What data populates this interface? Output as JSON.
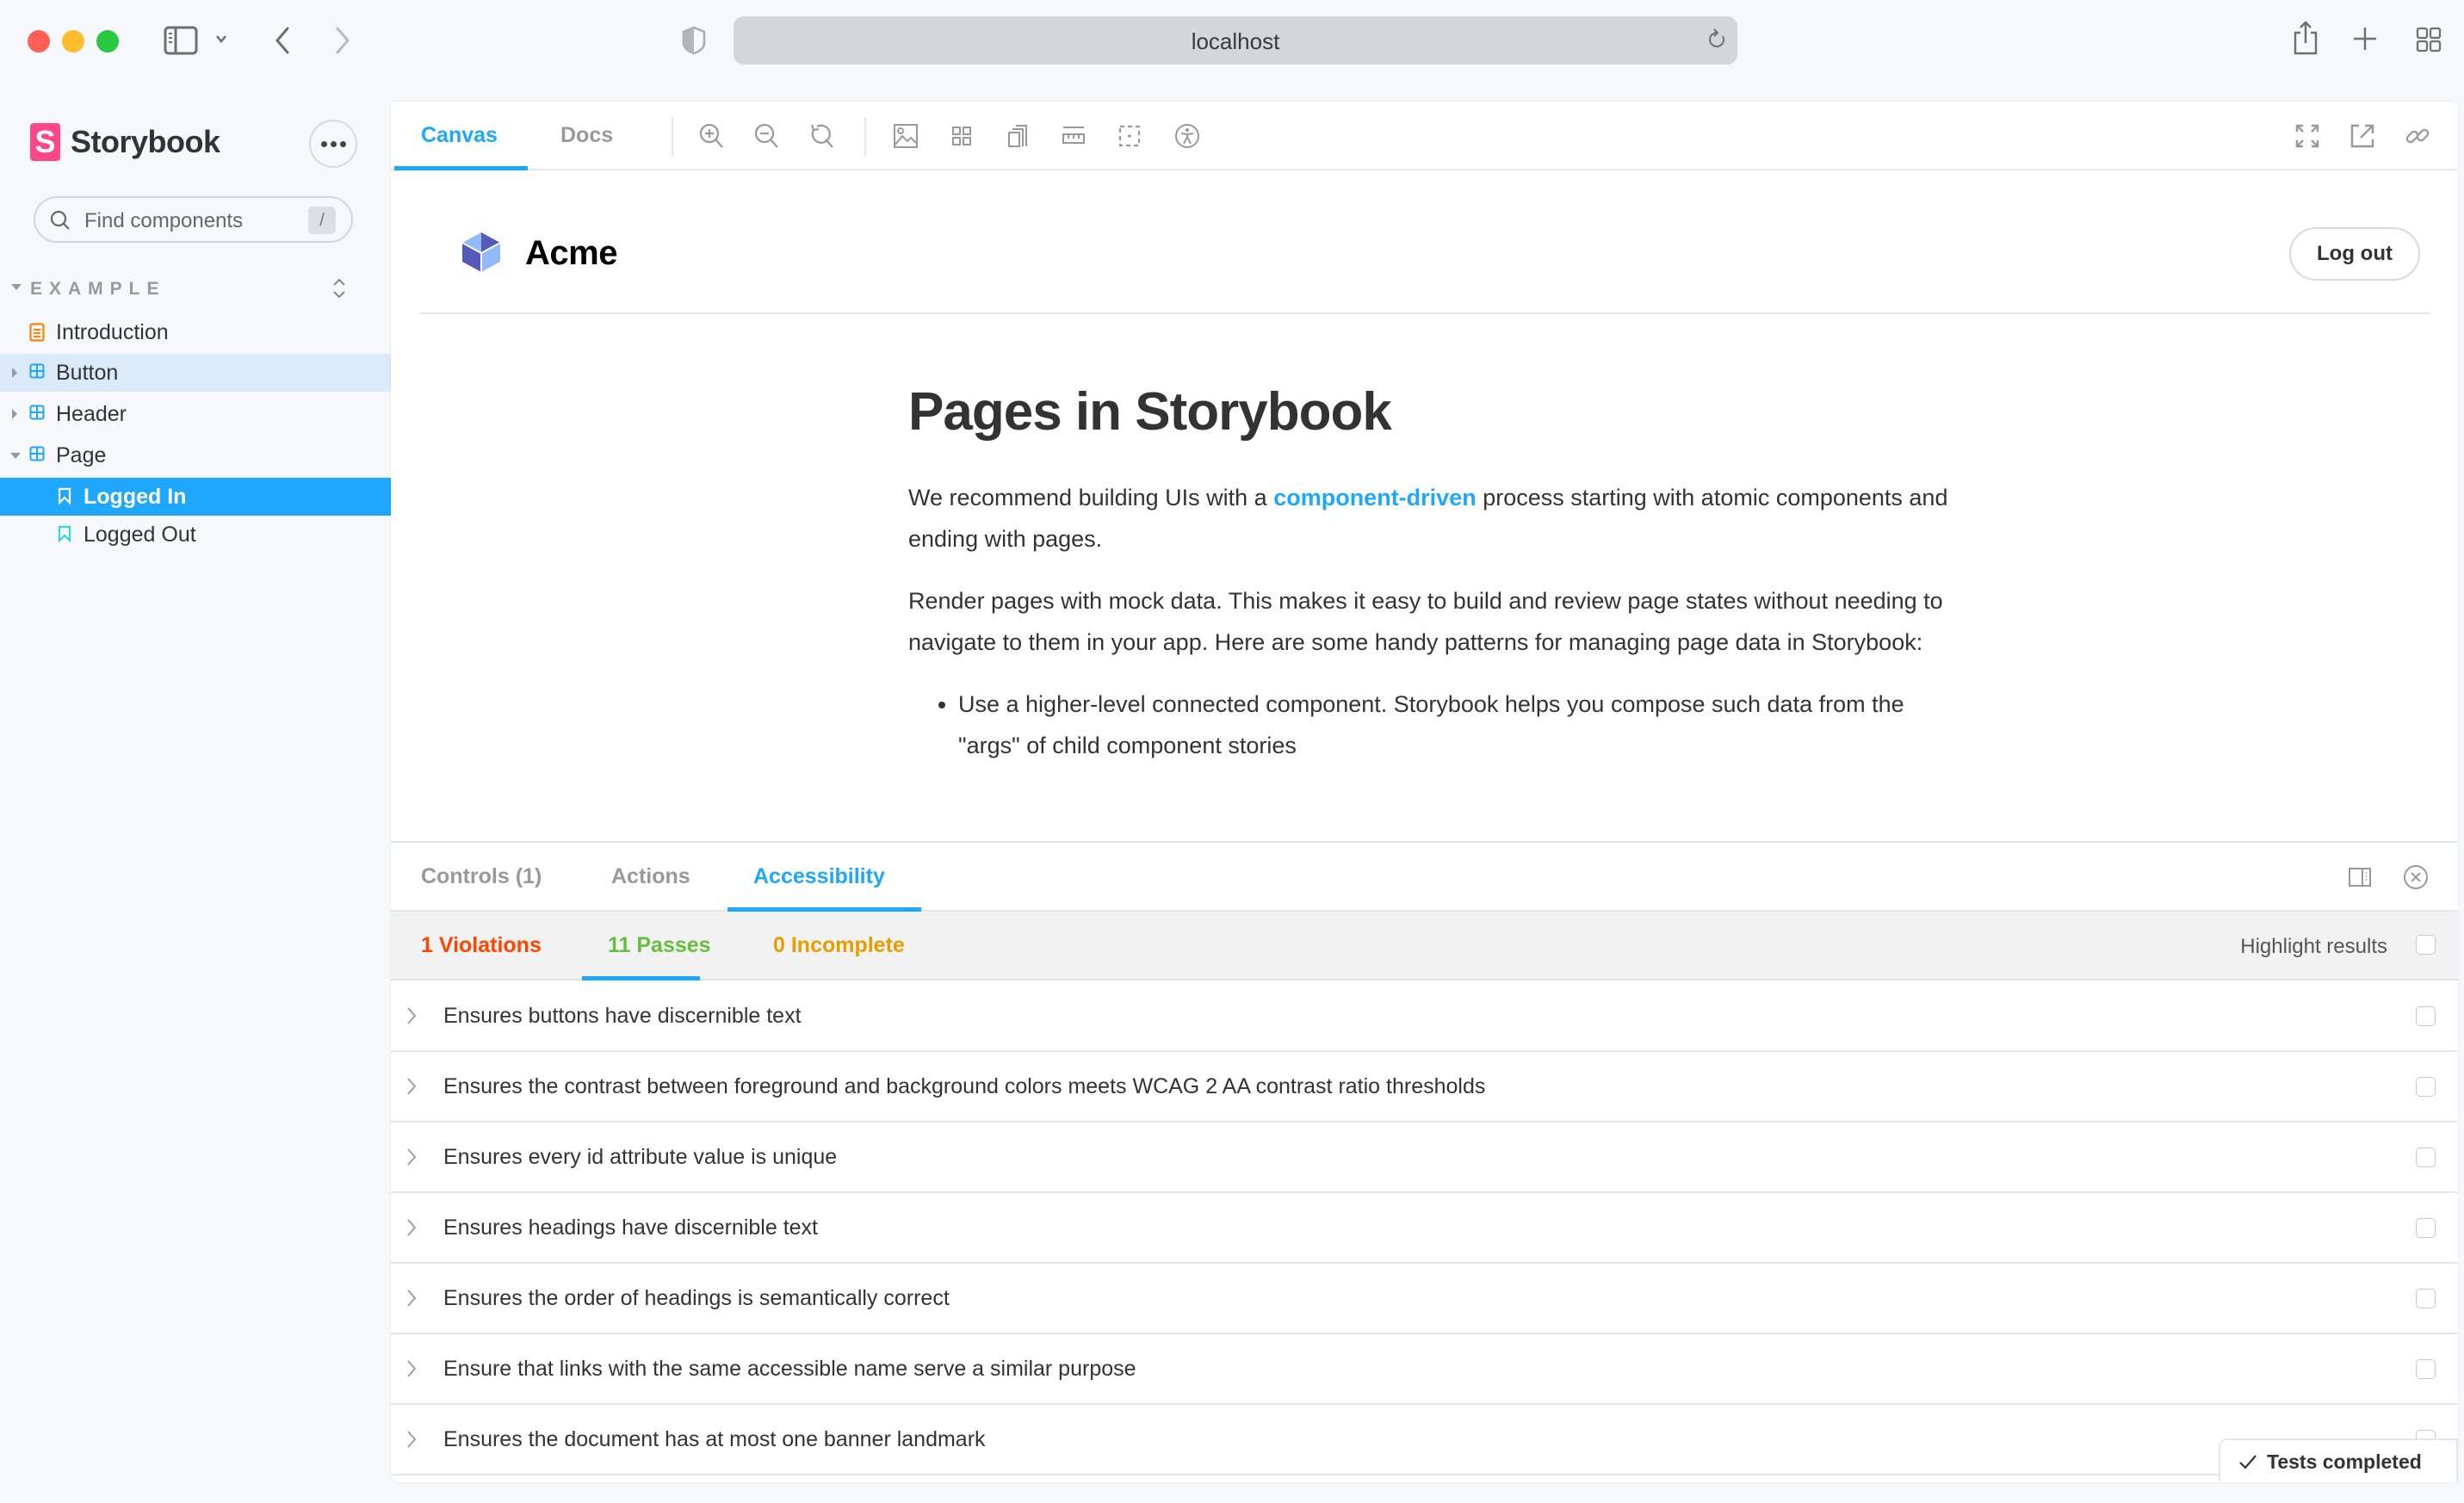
{
  "browser": {
    "url": "localhost",
    "icons": [
      "sidebar-toggle-icon",
      "chevron-down-icon",
      "back-icon",
      "forward-icon",
      "shield-icon",
      "reload-icon",
      "share-icon",
      "new-tab-icon",
      "tab-overview-icon"
    ]
  },
  "sidebar": {
    "brand": "Storybook",
    "brand_mark": "S",
    "search": {
      "placeholder": "Find components",
      "shortcut": "/"
    },
    "section": "EXAMPLE",
    "items": [
      {
        "label": "Introduction",
        "type": "docs",
        "depth": 0
      },
      {
        "label": "Button",
        "type": "component",
        "depth": 0,
        "expanded": false,
        "hovered": true
      },
      {
        "label": "Header",
        "type": "component",
        "depth": 0,
        "expanded": false
      },
      {
        "label": "Page",
        "type": "component",
        "depth": 0,
        "expanded": true
      },
      {
        "label": "Logged In",
        "type": "story",
        "depth": 1,
        "selected": true
      },
      {
        "label": "Logged Out",
        "type": "story",
        "depth": 1
      }
    ]
  },
  "toolbar": {
    "tabs": [
      {
        "label": "Canvas",
        "active": true
      },
      {
        "label": "Docs",
        "active": false
      }
    ],
    "tools": [
      "zoom-in-icon",
      "zoom-out-icon",
      "zoom-reset-icon",
      "background-icon",
      "grid-icon",
      "viewport-icon",
      "measure-icon",
      "outline-icon",
      "accessibility-icon"
    ],
    "right_tools": [
      "fullscreen-icon",
      "open-new-tab-icon",
      "copy-link-icon"
    ]
  },
  "preview": {
    "app_name": "Acme",
    "logout_label": "Log out",
    "heading": "Pages in Storybook",
    "p1_before": "We recommend building UIs with a ",
    "p1_link": "component-driven",
    "p1_after": " process starting with atomic components and ending with pages.",
    "p2": "Render pages with mock data. This makes it easy to build and review page states without needing to navigate to them in your app. Here are some handy patterns for managing page data in Storybook:",
    "bullets": [
      "Use a higher-level connected component. Storybook helps you compose such data from the \"args\" of child component stories"
    ]
  },
  "addons": {
    "tabs": [
      {
        "label": "Controls (1)",
        "active": false
      },
      {
        "label": "Actions",
        "active": false
      },
      {
        "label": "Accessibility",
        "active": true
      }
    ],
    "a11y": {
      "tabs": [
        {
          "label": "1 Violations",
          "color": "#ff4400",
          "active": false
        },
        {
          "label": "11 Passes",
          "color": "#66bf3c",
          "active": true
        },
        {
          "label": "0 Incomplete",
          "color": "#e69d00",
          "active": false
        }
      ],
      "highlight_label": "Highlight results",
      "highlight_checked": false,
      "rules": [
        "Ensures buttons have discernible text",
        "Ensures the contrast between foreground and background colors meets WCAG 2 AA contrast ratio thresholds",
        "Ensures every id attribute value is unique",
        "Ensures headings have discernible text",
        "Ensures the order of headings is semantically correct",
        "Ensure that links with the same accessible name serve a similar purpose",
        "Ensures the document has at most one banner landmark"
      ]
    },
    "status": "Tests completed"
  },
  "colors": {
    "accent": "#1ea7fd",
    "brand": "#ff4785",
    "violation": "#ff4400",
    "pass": "#66bf3c",
    "incomplete": "#e69d00"
  }
}
